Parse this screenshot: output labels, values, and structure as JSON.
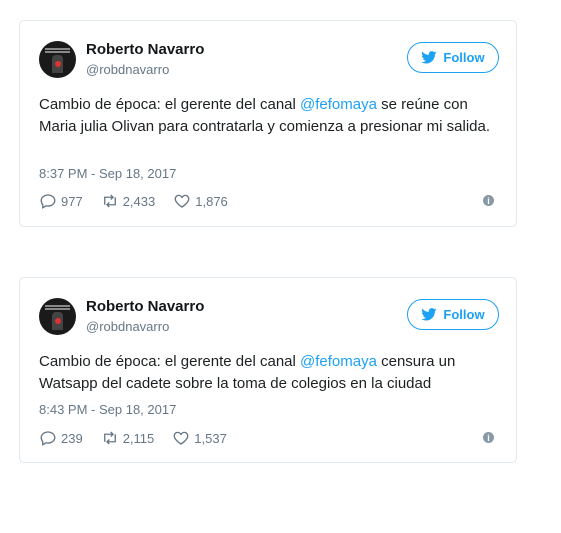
{
  "tweets": [
    {
      "name": "Roberto Navarro",
      "handle": "@robdnavarro",
      "follow_label": "Follow",
      "text_before": "Cambio de época: el gerente del canal ",
      "mention": "@fefomaya",
      "text_after": " se reúne con Maria julia Olivan para contratarla y comienza a presionar mi salida.",
      "timestamp": "8:37 PM - Sep 18, 2017",
      "replies": "977",
      "retweets": "2,433",
      "likes": "1,876"
    },
    {
      "name": "Roberto Navarro",
      "handle": "@robdnavarro",
      "follow_label": "Follow",
      "text_before": "Cambio de época: el gerente del canal ",
      "mention": "@fefomaya",
      "text_after": " censura un Watsapp del cadete sobre la toma de colegios en la ciudad",
      "timestamp": "8:43 PM - Sep 18, 2017",
      "replies": "239",
      "retweets": "2,115",
      "likes": "1,537"
    }
  ],
  "icons": {
    "reply": "reply-icon",
    "retweet": "retweet-icon",
    "like": "heart-icon",
    "info": "info-icon",
    "bird": "twitter-bird-icon"
  },
  "colors": {
    "accent": "#1da1f2",
    "muted": "#657786",
    "border": "#e1e8ed"
  }
}
